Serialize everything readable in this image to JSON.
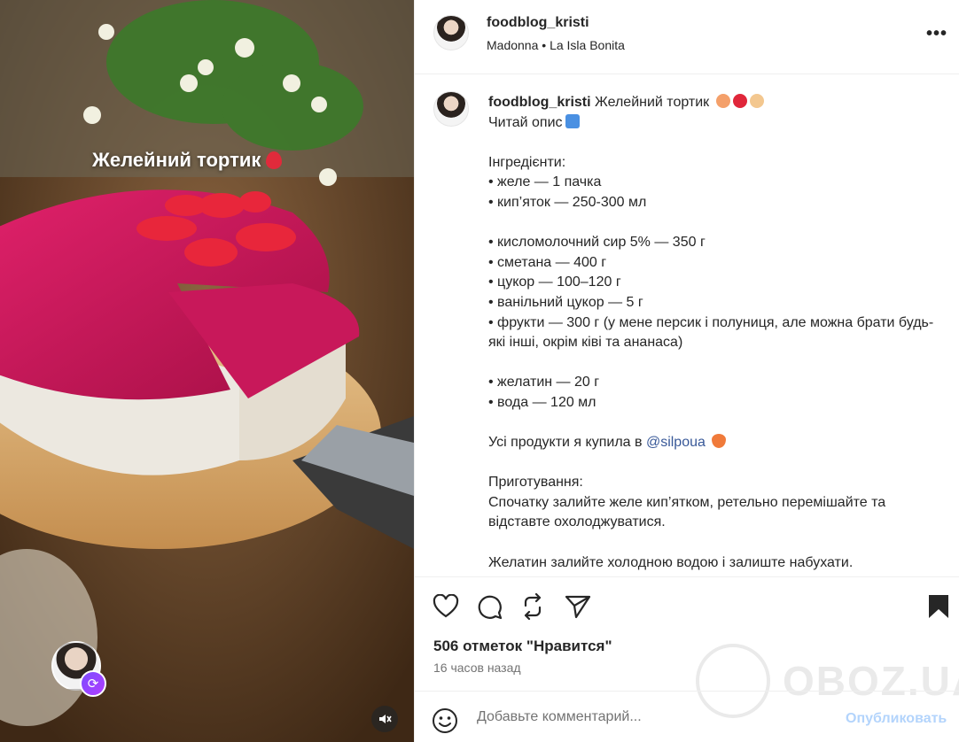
{
  "header": {
    "username": "foodblog_kristi",
    "audio_artist": "Madonna",
    "audio_separator": "•",
    "audio_track": "La Isla Bonita",
    "more_icon": "more-horizontal-icon"
  },
  "media": {
    "overlay_caption": "Желейний тортик",
    "remix_icon": "remix-icon",
    "mute_icon": "speaker-muted-icon"
  },
  "post": {
    "username": "foodblog_kristi",
    "title": "Желейний тортик",
    "line_read": "Читай опис",
    "ingredients_heading": "Інгредієнти:",
    "ing_1": "• желе — 1 пачка",
    "ing_2": "• кип’яток — 250-300 мл",
    "ing_3": "• кисломолочний сир 5% — 350 г",
    "ing_4": "• сметана — 400 г",
    "ing_5": "• цукор — 100–120 г",
    "ing_6": "• ванільний цукор — 5 г",
    "ing_7": "• фрукти — 300 г (у мене персик і полуниця, але можна брати будь-які інші, окрім ківі та ананаса)",
    "ing_8": "• желатин — 20 г",
    "ing_9": "• вода — 120 мл",
    "shop_text": "Усі продукти я купила в ",
    "shop_mention": "@silpoua",
    "prep_heading": "Приготування:",
    "prep_1": "Спочатку залийте желе кип’ятком, ретельно перемішайте та відставте охолоджуватися.",
    "prep_2": "Желатин залийте холодною водою і залиште набухати."
  },
  "actions": {
    "like_icon": "heart-icon",
    "comment_icon": "comment-icon",
    "repost_icon": "repost-icon",
    "share_icon": "share-icon",
    "save_icon": "bookmark-icon"
  },
  "stats": {
    "likes": "506 отметок \"Нравится\"",
    "time": "16 часов назад"
  },
  "comment": {
    "placeholder": "Добавьте комментарий...",
    "post_label": "Опубликовать"
  },
  "watermark": {
    "text": "OBOZ.UA"
  },
  "colors": {
    "accent_link": "#385898",
    "post_disabled": "#b3d4fc",
    "jelly": "#c8185a"
  }
}
